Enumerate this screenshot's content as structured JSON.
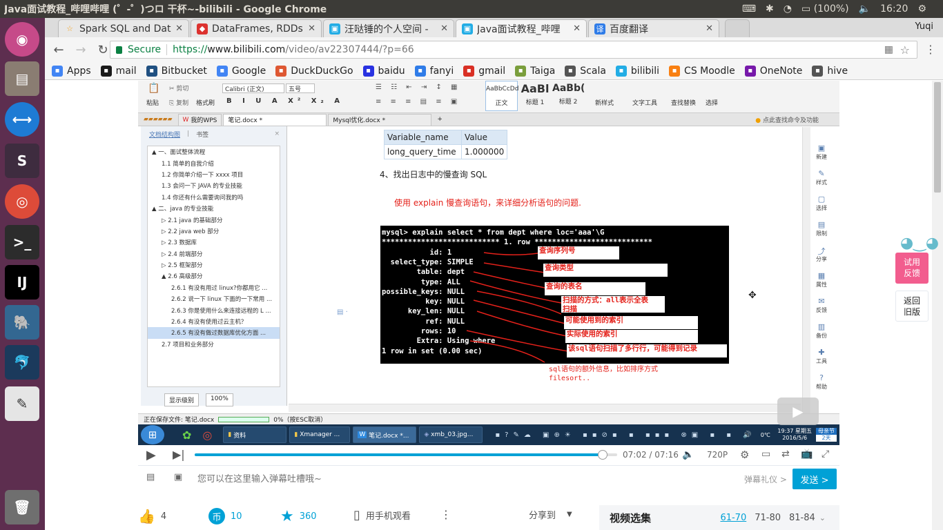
{
  "os": {
    "window_title": "Java面试教程_哔哩哔哩 (゜-゜)つロ 干杯~-bilibili - Google Chrome",
    "battery": "(100%)",
    "time": "16:20"
  },
  "chrome": {
    "profile": "Yuqi",
    "tabs": [
      {
        "label": "Spark SQL and Data",
        "icon": "star-icon",
        "color": "#f7a21b"
      },
      {
        "label": "DataFrames, RDDs,",
        "icon": "scala-icon",
        "color": "#dc322f"
      },
      {
        "label": "汪哒锤的个人空间 -",
        "icon": "bilibili-icon",
        "color": "#23ade5"
      },
      {
        "label": "Java面试教程_哔哩",
        "icon": "bilibili-icon",
        "color": "#23ade5"
      },
      {
        "label": "百度翻译",
        "icon": "translate-icon",
        "color": "#2f7ce8"
      }
    ],
    "secure_label": "Secure",
    "url_scheme": "https://",
    "url_domain": "www.bilibili.com",
    "url_path": "/video/av22307444/?p=66",
    "bookmarks": [
      {
        "label": "Apps",
        "color": "#4285f4",
        "icon": "apps-grid-icon"
      },
      {
        "label": "mail",
        "color": "#1a1a1a",
        "icon": "mail-icon"
      },
      {
        "label": "Bitbucket",
        "color": "#205081",
        "icon": "bitbucket-icon"
      },
      {
        "label": "Google",
        "color": "#4285f4",
        "icon": "google-icon"
      },
      {
        "label": "DuckDuckGo",
        "color": "#de5833",
        "icon": "duckduckgo-icon"
      },
      {
        "label": "baidu",
        "color": "#2932e1",
        "icon": "baidu-paw-icon"
      },
      {
        "label": "fanyi",
        "color": "#2f7ce8",
        "icon": "translate-icon"
      },
      {
        "label": "gmail",
        "color": "#d93025",
        "icon": "gmail-icon"
      },
      {
        "label": "Taiga",
        "color": "#7a9e3c",
        "icon": "taiga-icon"
      },
      {
        "label": "Scala",
        "color": "#555555",
        "icon": "folder-icon"
      },
      {
        "label": "bilibili",
        "color": "#23ade5",
        "icon": "bilibili-icon"
      },
      {
        "label": "CS Moodle",
        "color": "#f98012",
        "icon": "moodle-icon"
      },
      {
        "label": "OneNote",
        "color": "#7719aa",
        "icon": "onenote-icon"
      },
      {
        "label": "hive",
        "color": "#555555",
        "icon": "folder-icon"
      }
    ]
  },
  "wps": {
    "ribbon": {
      "paste": "粘贴",
      "cut": "剪切",
      "copy": "复制",
      "format_painter": "格式刷",
      "font": "Calibri (正文)",
      "size": "五号",
      "styles": [
        {
          "preview": "AaBbCcDd",
          "label": "正文"
        },
        {
          "preview": "AaBl",
          "label": "标题 1"
        },
        {
          "preview": "AaBb(",
          "label": "标题 2"
        }
      ],
      "new_style": "新样式",
      "text_tools": "文字工具",
      "find_replace": "查找替换",
      "select": "选择"
    },
    "doc_tabs": [
      "我的WPS",
      "笔记.docx *",
      "Mysql优化.docx *"
    ],
    "tab_hint": "点此查找命令及功能",
    "nav_tabs": [
      "文档结构图",
      "书签"
    ],
    "outline": [
      {
        "level": 0,
        "text": "▲ 一、面试整体流程"
      },
      {
        "level": 1,
        "text": "1.1 简单的自我介绍"
      },
      {
        "level": 1,
        "text": "1.2 你简单介绍一下 xxxx 项目"
      },
      {
        "level": 1,
        "text": "1.3 会问一下 JAVA 的专业技能"
      },
      {
        "level": 1,
        "text": "1.4 你还有什么需要询问我的吗"
      },
      {
        "level": 0,
        "text": "▲ 二、java 的专业技能"
      },
      {
        "level": 1,
        "text": "▷ 2.1 java 的基础部分"
      },
      {
        "level": 1,
        "text": "▷ 2.2 java web 部分"
      },
      {
        "level": 1,
        "text": "▷ 2.3 数据库"
      },
      {
        "level": 1,
        "text": "▷ 2.4 前端部分"
      },
      {
        "level": 1,
        "text": "▷ 2.5 框架部分"
      },
      {
        "level": 1,
        "text": "▲ 2.6 高级部分"
      },
      {
        "level": 2,
        "text": "2.6.1 有没有用过 linux?你都用它 ..."
      },
      {
        "level": 2,
        "text": "2.6.2 说一下 linux 下面的一下常用 ..."
      },
      {
        "level": 2,
        "text": "2.6.3 你是使用什么来连接远程的 L ..."
      },
      {
        "level": 2,
        "text": "2.6.4 有没有使用过云主机？"
      },
      {
        "level": 2,
        "text": "2.6.5 有没有做过数据库优化方面 ..."
      },
      {
        "level": 1,
        "text": "2.7 项目和业务部分"
      }
    ],
    "selected_outline_index": 16,
    "nav_level": "显示级别",
    "nav_zoom": "100%",
    "table_header": [
      "Variable_name",
      "Value"
    ],
    "table_row": [
      "long_query_time",
      "1.000000"
    ],
    "step": "4、找出日志中的慢查询 SQL",
    "note": "使用 explain 慢查询语句，来详细分析语句的问题.",
    "terminal_lines": [
      "mysql> explain select * from dept where loc='aaa'\\G",
      "*************************** 1. row ***************************",
      "           id: 1",
      "  select_type: SIMPLE",
      "        table: dept",
      "         type: ALL",
      "possible_keys: NULL",
      "          key: NULL",
      "      key_len: NULL",
      "          ref: NULL",
      "         rows: 10",
      "        Extra: Using where",
      "1 row in set (0.00 sec)"
    ],
    "annotations": [
      "查询序列号",
      "查询类型",
      "查询的表名",
      "扫描的方式：all表示全表\n扫描",
      "可能使用到的索引",
      "实际使用的索引",
      "该sql语句扫描了多行行，可能得到记录"
    ],
    "extra_note": "sql语句的额外信息，比如排序方式\nfilesort..",
    "right_tools": [
      "新建",
      "样式",
      "选择",
      "限制",
      "分享",
      "属性",
      "反馈",
      "备份",
      "工具",
      "帮助"
    ],
    "status": "正在保存文件: 笔记.docx",
    "status_pct": "0%（按ESC取消）",
    "taskbar": [
      "资料",
      "Xmanager ...",
      "笔记.docx *...",
      "xmb_03.jpg..."
    ],
    "tray_time": "19:37 星期五",
    "tray_date": "2016/5/6",
    "tray_temp": "0℃",
    "tray_badge_top": "母亲节",
    "tray_badge_bottom": "2天"
  },
  "player": {
    "current": "07:02",
    "separator": "/",
    "duration": "07:16",
    "progress_fraction": 0.966,
    "quality": "720P",
    "danmaku_placeholder": "您可以在这里输入弹幕吐槽哦~",
    "danmaku_etiquette": "弹幕礼仪 >",
    "send": "发送 >"
  },
  "actions": {
    "likes": "4",
    "coins": "10",
    "favorites": "360",
    "mobile": "用手机观看",
    "share": "分享到"
  },
  "playlist": {
    "title": "视频选集",
    "ranges": [
      "61-70",
      "71-80",
      "81-84"
    ]
  },
  "side": {
    "feedback": "试用\n反馈",
    "back": "返回\n旧版"
  }
}
